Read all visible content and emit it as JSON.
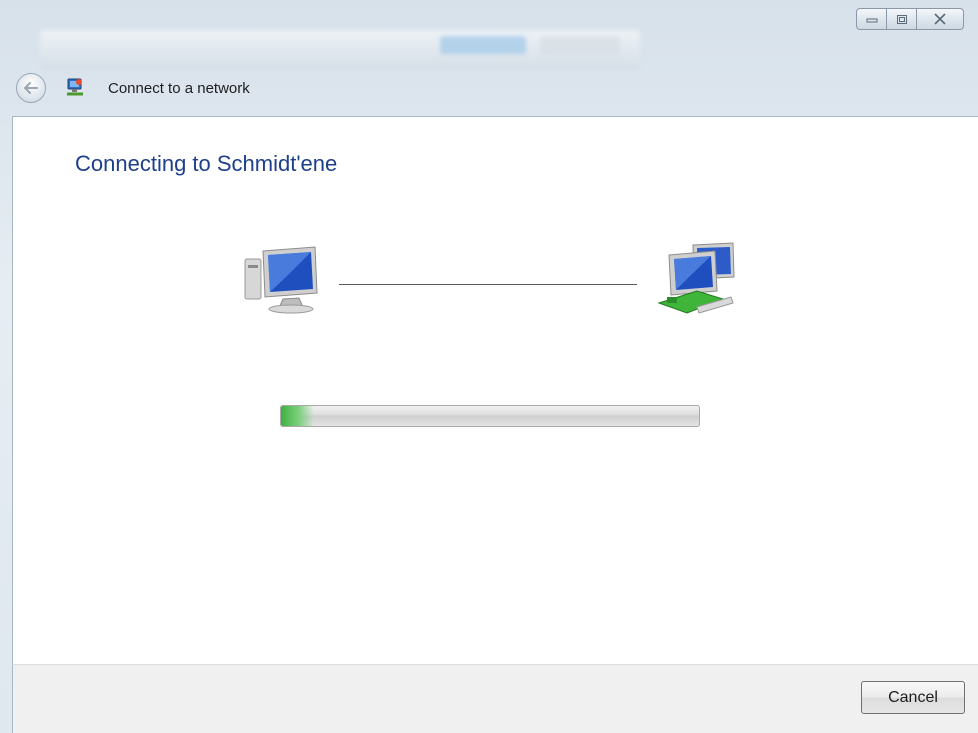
{
  "window": {
    "title": "Connect to a network",
    "heading": "Connecting to Schmidt'ene"
  },
  "progress": {
    "value_percent": 8
  },
  "footer": {
    "cancel_label": "Cancel"
  },
  "colors": {
    "heading": "#1e3f8c",
    "progress_fill": "#3cb043"
  },
  "icons": {
    "back": "back-arrow-icon",
    "title_icon": "network-icon",
    "source": "computer-icon",
    "target": "network-computers-icon"
  }
}
